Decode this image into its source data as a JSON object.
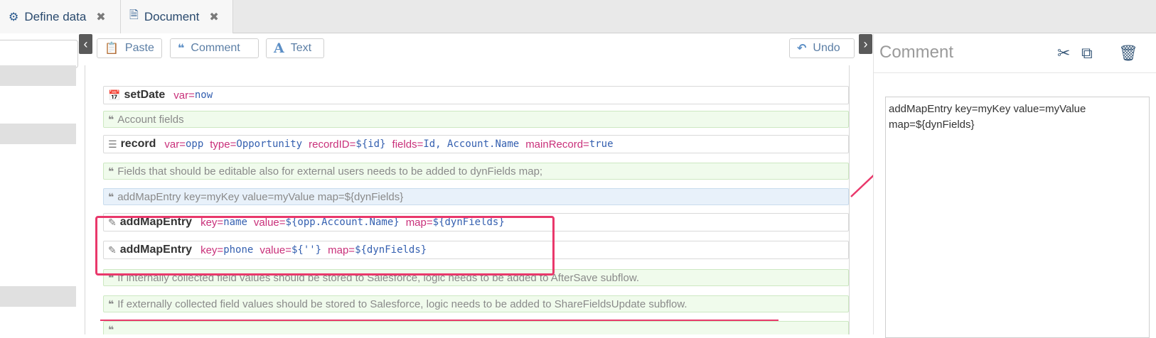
{
  "tabs": [
    {
      "label": "Define data",
      "icon": "flow-icon"
    },
    {
      "label": "Document",
      "icon": "document-icon"
    }
  ],
  "toolbar": {
    "paste": "Paste",
    "comment": "Comment",
    "text": "Text",
    "undo": "Undo"
  },
  "rows": {
    "r1": {
      "cmd": "setDate",
      "a1": "var=",
      "v1": "now"
    },
    "r2": {
      "text": "Account fields"
    },
    "r3": {
      "cmd": "record",
      "a1": "var=",
      "v1": "opp",
      "a2": "type=",
      "v2": "Opportunity",
      "a3": "recordID=",
      "v3": "${id}",
      "a4": "fields=",
      "v4": "Id, Account.Name",
      "a5": "mainRecord=",
      "v5": "true"
    },
    "r4": {
      "text": "Fields that should be editable also for external users needs to be added to dynFields map;"
    },
    "r5": {
      "text": "addMapEntry key=myKey value=myValue map=${dynFields}"
    },
    "r6": {
      "cmd": "addMapEntry",
      "a1": "key=",
      "v1": "name",
      "a2": "value=",
      "v2": "${opp.Account.Name}",
      "a3": "map=",
      "v3": "${dynFields}"
    },
    "r7": {
      "cmd": "addMapEntry",
      "a1": "key=",
      "v1": "phone",
      "a2": "value=",
      "v2": "${''}",
      "a3": "map=",
      "v3": "${dynFields}"
    },
    "r8": {
      "text": "If internally collected field values should be stored to Salesforce, logic needs to be added to AfterSave subflow."
    },
    "r9": {
      "text": "If externally collected field values should be stored to Salesforce, logic needs to be added to ShareFieldsUpdate subflow."
    }
  },
  "panel": {
    "title": "Comment",
    "content": "addMapEntry key=myKey value=myValue\nmap=${dynFields}"
  },
  "colors": {
    "highlight": "#e9386b",
    "attribute": "#c9307a",
    "value": "#3560b0",
    "comment_bg": "#f0fbec",
    "selected_bg": "#e8f1fa"
  }
}
